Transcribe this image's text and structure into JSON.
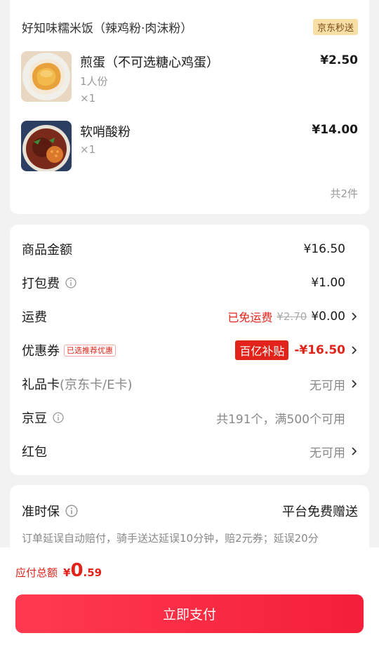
{
  "order": {
    "store_name": "好知味糯米饭（辣鸡粉·肉沫粉）",
    "store_badge": "京东秒送",
    "items": [
      {
        "name": "煎蛋（不可选糖心鸡蛋）",
        "spec": "1人份",
        "qty": "×1",
        "price": "¥2.50"
      },
      {
        "name": "软哨酸粉",
        "spec": "",
        "qty": "×1",
        "price": "¥14.00"
      }
    ],
    "total_count": "共2件"
  },
  "fees": {
    "goods_amount": {
      "label": "商品金额",
      "value": "¥16.50"
    },
    "packing_fee": {
      "label": "打包费",
      "value": "¥1.00"
    },
    "shipping": {
      "label": "运费",
      "note": "已免运费",
      "original": "¥2.70",
      "value": "¥0.00"
    },
    "coupon": {
      "label": "优惠券",
      "tag": "已选推荐优惠",
      "subsidy": "百亿补贴",
      "value": "-¥16.50"
    },
    "gift_card": {
      "label": "礼品卡",
      "label_suffix": "(京东卡/E卡)",
      "value": "无可用"
    },
    "jingdou": {
      "label": "京豆",
      "value": "共191个，满500个可用"
    },
    "red_packet": {
      "label": "红包",
      "value": "无可用"
    }
  },
  "protection": {
    "label": "准时保",
    "value": "平台免费赠送",
    "desc": "订单延误自动赔付，骑手送达延误10分钟，赔2元券；延误20分"
  },
  "bottom": {
    "total_label": "应付总额",
    "currency": "¥",
    "amount_int": "0",
    "amount_dec": ".59",
    "pay_button": "立即支付"
  },
  "colors": {
    "accent": "#e2231a",
    "badge_bg": "#f8dfa6",
    "button": "#f41f3a"
  }
}
